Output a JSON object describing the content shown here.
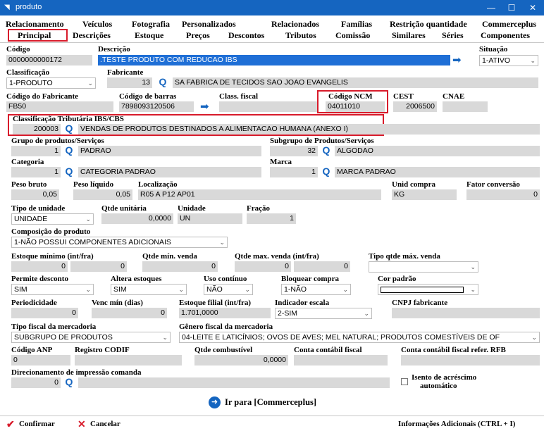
{
  "window": {
    "title": "produto",
    "minimize": "—",
    "maximize": "☐",
    "close": "✕"
  },
  "tabs_row1": [
    "Relacionamento",
    "Veículos",
    "Fotografia",
    "Personalizados",
    "Relacionados",
    "Famílias",
    "Restrição quantidade",
    "Commerceplus"
  ],
  "tabs_row2": [
    "Principal",
    "Descrições",
    "Estoque",
    "Preços",
    "Descontos",
    "Tributos",
    "Comissão",
    "Similares",
    "Séries",
    "Componentes"
  ],
  "fields": {
    "codigo": {
      "label": "Código",
      "value": "0000000000172"
    },
    "descricao": {
      "label": "Descrição",
      "value": ".TESTE PRODUTO COM REDUCAO IBS"
    },
    "situacao": {
      "label": "Situação",
      "value": "1-ATIVO"
    },
    "classificacao": {
      "label": "Classificação",
      "value": "1-PRODUTO"
    },
    "fabricante": {
      "label": "Fabricante",
      "code": "13",
      "value": "SA FABRICA DE TECIDOS SAO JOAO EVANGELIS"
    },
    "codigo_fabricante": {
      "label": "Código do Fabricante",
      "value": "FB50"
    },
    "codigo_barras": {
      "label": "Código de barras",
      "value": "7898093120506"
    },
    "class_fiscal": {
      "label": "Class. fiscal",
      "value": ""
    },
    "codigo_ncm": {
      "label": "Código NCM",
      "value": "04011010"
    },
    "cest": {
      "label": "CEST",
      "value": "2006500"
    },
    "cnae": {
      "label": "CNAE",
      "value": ""
    },
    "class_trib": {
      "label": "Classificação Tributária IBS/CBS",
      "code": "200003",
      "value": "VENDAS DE PRODUTOS DESTINADOS A ALIMENTACAO HUMANA (ANEXO I)"
    },
    "grupo": {
      "label": "Grupo de produtos/Serviços",
      "code": "1",
      "value": "PADRAO"
    },
    "subgrupo": {
      "label": "Subgrupo de Produtos/Serviços",
      "code": "32",
      "value": "ALGODAO"
    },
    "categoria": {
      "label": "Categoria",
      "code": "1",
      "value": "CATEGORIA PADRAO"
    },
    "marca": {
      "label": "Marca",
      "code": "1",
      "value": "MARCA PADRAO"
    },
    "peso_bruto": {
      "label": "Peso bruto",
      "value": "0,05"
    },
    "peso_liquido": {
      "label": "Peso líquido",
      "value": "0,05"
    },
    "localizacao": {
      "label": "Localização",
      "value": "R05 A   P12   AP01"
    },
    "unid_compra": {
      "label": "Unid compra",
      "value": "KG"
    },
    "fator_conversao": {
      "label": "Fator conversão",
      "value": "0"
    },
    "tipo_unidade": {
      "label": "Tipo de unidade",
      "value": "UNIDADE"
    },
    "qtde_unitaria": {
      "label": "Qtde unitária",
      "value": "0,0000"
    },
    "unidade": {
      "label": "Unidade",
      "value": "UN"
    },
    "fracao": {
      "label": "Fração",
      "value": "1"
    },
    "composicao": {
      "label": "Composição do produto",
      "value": "1-NÃO POSSUI COMPONENTES ADICIONAIS"
    },
    "estoque_minimo": {
      "label": "Estoque mínimo (int/fra)",
      "v1": "0",
      "v2": "0"
    },
    "qtde_min_venda": {
      "label": "Qtde mín. venda",
      "value": "0"
    },
    "qtde_max_venda": {
      "label": "Qtde max. venda (int/fra)",
      "v1": "0",
      "v2": "0"
    },
    "tipo_qtde_max": {
      "label": "Tipo qtde máx. venda",
      "value": ""
    },
    "permite_desconto": {
      "label": "Permite desconto",
      "value": "SIM"
    },
    "altera_estoques": {
      "label": "Altera estoques",
      "value": "SIM"
    },
    "uso_continuo": {
      "label": "Uso contínuo",
      "value": "NÃO"
    },
    "bloquear_compra": {
      "label": "Bloquear compra",
      "value": "1-NÃO"
    },
    "cor_padrao": {
      "label": "Cor padrão",
      "value": ""
    },
    "periodicidade": {
      "label": "Periodicidade",
      "value": "0"
    },
    "venc_min": {
      "label": "Venc mín (dias)",
      "value": "0"
    },
    "estoque_filial": {
      "label": "Estoque filial (int/fra)",
      "value": "1.701,0000"
    },
    "indicador_escala": {
      "label": "Indicador escala",
      "value": "2-SIM"
    },
    "cnpj_fabricante": {
      "label": "CNPJ fabricante",
      "value": ""
    },
    "tipo_fiscal": {
      "label": "Tipo fiscal da mercadoria",
      "value": "SUBGRUPO DE PRODUTOS"
    },
    "genero_fiscal": {
      "label": "Gênero fiscal da mercadoria",
      "value": "04-LEITE E LATICÍNIOS; OVOS DE AVES; MEL NATURAL; PRODUTOS COMESTÍVEIS DE OF"
    },
    "codigo_anp": {
      "label": "Código ANP",
      "value": "0"
    },
    "registro_codif": {
      "label": "Registro CODIF",
      "value": ""
    },
    "qtde_combustivel": {
      "label": "Qtde combustível",
      "value": "0,0000"
    },
    "conta_contabil": {
      "label": "Conta contábil fiscal",
      "value": ""
    },
    "conta_contabil_rfb": {
      "label": "Conta contábil fiscal refer. RFB",
      "value": ""
    },
    "direcionamento": {
      "label": "Direcionamento de impressão comanda",
      "code": "0",
      "value": ""
    },
    "isento": {
      "label_line1": "Isento de acréscimo",
      "label_line2": "automático"
    }
  },
  "go_commerceplus": "Ir para [Commerceplus]",
  "footer": {
    "confirmar": "Confirmar",
    "cancelar": "Cancelar",
    "info": "Informações Adicionais (CTRL + I)"
  },
  "colors": {
    "titlebar": "#1565c0",
    "highlight_red": "#d81b2b",
    "field_gray": "#d9d9d9",
    "selection_blue": "#1f6fd6",
    "icon_blue": "#1565c0"
  }
}
